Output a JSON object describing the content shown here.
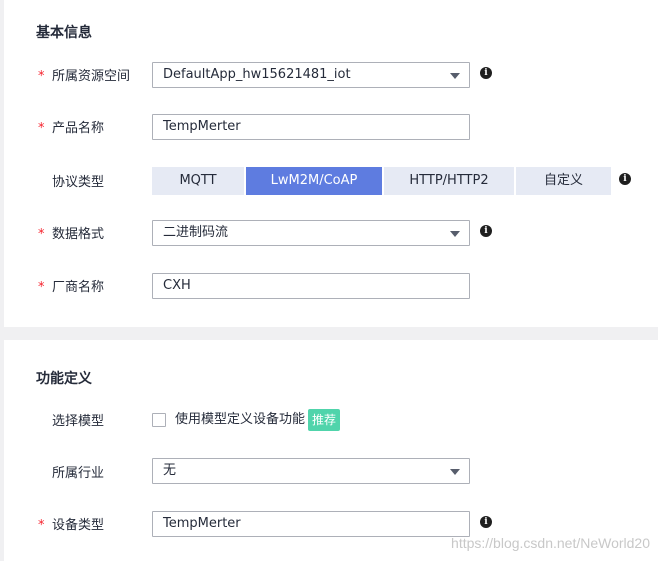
{
  "basic": {
    "title": "基本信息",
    "app_space": {
      "label": "所属资源空间",
      "value": "DefaultApp_hw15621481_iot"
    },
    "product_name": {
      "label": "产品名称",
      "value": "TempMerter"
    },
    "protocol": {
      "label": "协议类型",
      "options": [
        "MQTT",
        "LwM2M/CoAP",
        "HTTP/HTTP2",
        "自定义"
      ],
      "selected": "LwM2M/CoAP"
    },
    "data_format": {
      "label": "数据格式",
      "value": "二进制码流"
    },
    "vendor": {
      "label": "厂商名称",
      "value": "CXH"
    }
  },
  "func": {
    "title": "功能定义",
    "model": {
      "label": "选择模型",
      "checkbox_text": "使用模型定义设备功能",
      "badge": "推荐"
    },
    "industry": {
      "label": "所属行业",
      "value": "无"
    },
    "device_type": {
      "label": "设备类型",
      "value": "TempMerter"
    }
  },
  "required_mark": "*",
  "info_icon_glyph": "i",
  "watermark": "https://blog.csdn.net/NeWorld20",
  "colors": {
    "primary": "#5e7ce0",
    "required": "#f5222d",
    "badge": "#50d4ab"
  }
}
